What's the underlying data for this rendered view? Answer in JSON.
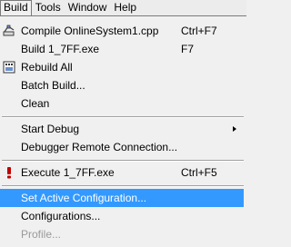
{
  "menubar": {
    "items": [
      "Build",
      "Tools",
      "Window",
      "Help"
    ]
  },
  "menu": {
    "compile": {
      "label": "Compile OnlineSystem1.cpp",
      "shortcut": "Ctrl+F7",
      "icon": "compile-icon"
    },
    "build": {
      "label": "Build 1_7FF.exe",
      "shortcut": "F7"
    },
    "rebuild": {
      "label": "Rebuild All",
      "icon": "rebuild-icon"
    },
    "batch": {
      "label": "Batch Build..."
    },
    "clean": {
      "label": "Clean"
    },
    "start_debug": {
      "label": "Start Debug",
      "submenu": true
    },
    "remote": {
      "label": "Debugger Remote Connection..."
    },
    "execute": {
      "label": "Execute 1_7FF.exe",
      "shortcut": "Ctrl+F5",
      "icon": "exclamation-icon"
    },
    "set_active": {
      "label": "Set Active Configuration...",
      "highlighted": true
    },
    "configurations": {
      "label": "Configurations..."
    },
    "profile": {
      "label": "Profile...",
      "disabled": true
    }
  },
  "colors": {
    "highlight": "#3399ff",
    "menu_bg": "#f0f0f0",
    "disabled_text": "#9a9a9a",
    "execute_icon": "#c00000"
  }
}
